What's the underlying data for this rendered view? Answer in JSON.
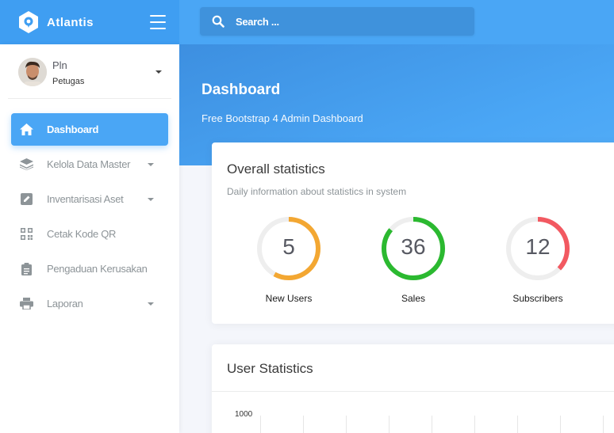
{
  "brand": {
    "name": "Atlantis"
  },
  "search": {
    "placeholder": "Search ..."
  },
  "user": {
    "name": "Pln",
    "role": "Petugas"
  },
  "sidebar": {
    "items": [
      {
        "label": "Dashboard",
        "icon": "home-icon",
        "active": true,
        "caret": false
      },
      {
        "label": "Kelola Data Master",
        "icon": "layers-icon",
        "active": false,
        "caret": true
      },
      {
        "label": "Inventarisasi Aset",
        "icon": "edit-icon",
        "active": false,
        "caret": true
      },
      {
        "label": "Cetak Kode QR",
        "icon": "qrcode-icon",
        "active": false,
        "caret": false
      },
      {
        "label": "Pengaduan Kerusakan",
        "icon": "clipboard-icon",
        "active": false,
        "caret": false
      },
      {
        "label": "Laporan",
        "icon": "printer-icon",
        "active": false,
        "caret": true
      }
    ]
  },
  "header": {
    "title": "Dashboard",
    "subtitle": "Free Bootstrap 4 Admin Dashboard"
  },
  "overall": {
    "title": "Overall statistics",
    "category": "Daily information about statistics in system",
    "circles": [
      {
        "value": "5",
        "label": "New Users",
        "color": "#f3a732",
        "fraction": 0.58
      },
      {
        "value": "36",
        "label": "Sales",
        "color": "#2bb930",
        "fraction": 0.86
      },
      {
        "value": "12",
        "label": "Subscribers",
        "color": "#f25961",
        "fraction": 0.37
      }
    ]
  },
  "user_statistics": {
    "title": "User Statistics",
    "y_tick_top": "1000"
  },
  "colors": {
    "primary": "#4aa6f5",
    "sidebar_active": "#4aa6f5",
    "track": "#eeeeee"
  }
}
